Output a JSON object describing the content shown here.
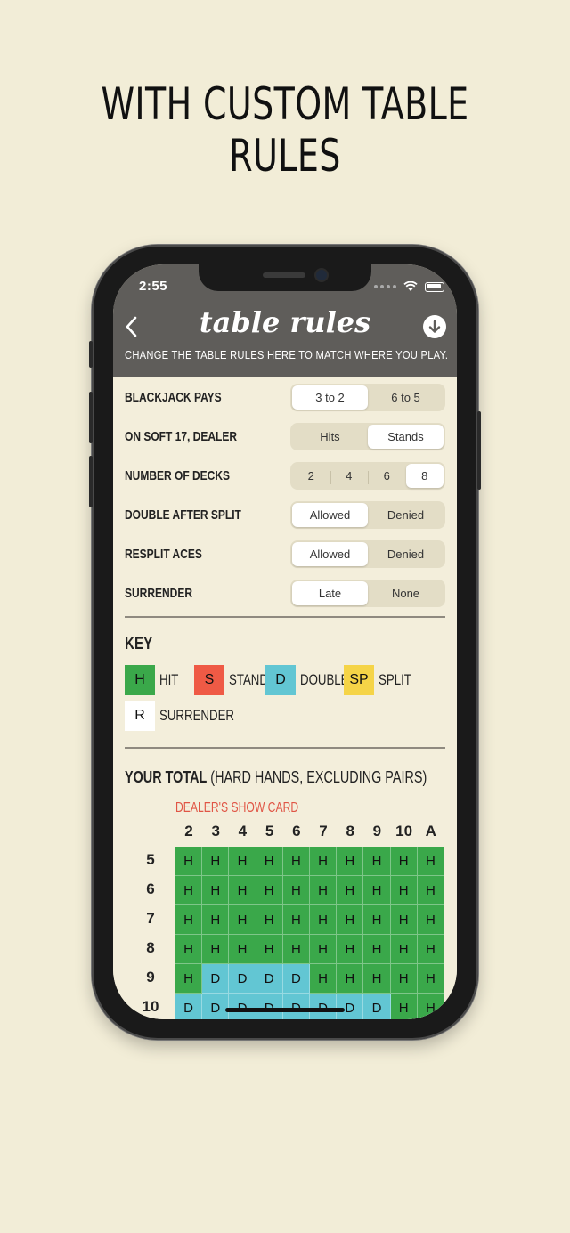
{
  "headline": "WITH CUSTOM TABLE RULES",
  "status": {
    "time": "2:55"
  },
  "nav": {
    "title": "table rules",
    "subtitle": "CHANGE THE TABLE RULES HERE TO MATCH WHERE YOU PLAY."
  },
  "rules": [
    {
      "label": "BLACKJACK PAYS",
      "options": [
        "3 to 2",
        "6 to 5"
      ],
      "selected": 0
    },
    {
      "label": "ON SOFT 17, DEALER",
      "options": [
        "Hits",
        "Stands"
      ],
      "selected": 1
    },
    {
      "label": "NUMBER OF DECKS",
      "options": [
        "2",
        "4",
        "6",
        "8"
      ],
      "selected": 3
    },
    {
      "label": "DOUBLE AFTER SPLIT",
      "options": [
        "Allowed",
        "Denied"
      ],
      "selected": 0
    },
    {
      "label": "RESPLIT ACES",
      "options": [
        "Allowed",
        "Denied"
      ],
      "selected": 0
    },
    {
      "label": "SURRENDER",
      "options": [
        "Late",
        "None"
      ],
      "selected": 0
    }
  ],
  "key": {
    "title": "KEY",
    "items": [
      {
        "code": "H",
        "label": "HIT",
        "color": "#3aa84a"
      },
      {
        "code": "S",
        "label": "STAND",
        "color": "#ef5a45"
      },
      {
        "code": "D",
        "label": "DOUBLE",
        "color": "#62c6d3"
      },
      {
        "code": "SP",
        "label": "SPLIT",
        "color": "#f5d447"
      },
      {
        "code": "R",
        "label": "SURRENDER",
        "color": "#ffffff"
      }
    ]
  },
  "strategy": {
    "title_bold": "YOUR TOTAL",
    "title_rest": " (HARD HANDS, EXCLUDING PAIRS)",
    "dealer_label": "DEALER'S SHOW CARD",
    "columns": [
      "2",
      "3",
      "4",
      "5",
      "6",
      "7",
      "8",
      "9",
      "10",
      "A"
    ],
    "rows": [
      {
        "total": "5",
        "cells": [
          "H",
          "H",
          "H",
          "H",
          "H",
          "H",
          "H",
          "H",
          "H",
          "H"
        ]
      },
      {
        "total": "6",
        "cells": [
          "H",
          "H",
          "H",
          "H",
          "H",
          "H",
          "H",
          "H",
          "H",
          "H"
        ]
      },
      {
        "total": "7",
        "cells": [
          "H",
          "H",
          "H",
          "H",
          "H",
          "H",
          "H",
          "H",
          "H",
          "H"
        ]
      },
      {
        "total": "8",
        "cells": [
          "H",
          "H",
          "H",
          "H",
          "H",
          "H",
          "H",
          "H",
          "H",
          "H"
        ]
      },
      {
        "total": "9",
        "cells": [
          "H",
          "D",
          "D",
          "D",
          "D",
          "H",
          "H",
          "H",
          "H",
          "H"
        ]
      },
      {
        "total": "10",
        "cells": [
          "D",
          "D",
          "D",
          "D",
          "D",
          "D",
          "D",
          "D",
          "H",
          "H"
        ]
      }
    ]
  },
  "colors": {
    "background": "#f2edd7",
    "header": "#5f5d5a",
    "hit": "#3aa84a",
    "double": "#62c6d3",
    "stand": "#ef5a45",
    "split": "#f5d447",
    "dealer_label": "#e05545"
  }
}
